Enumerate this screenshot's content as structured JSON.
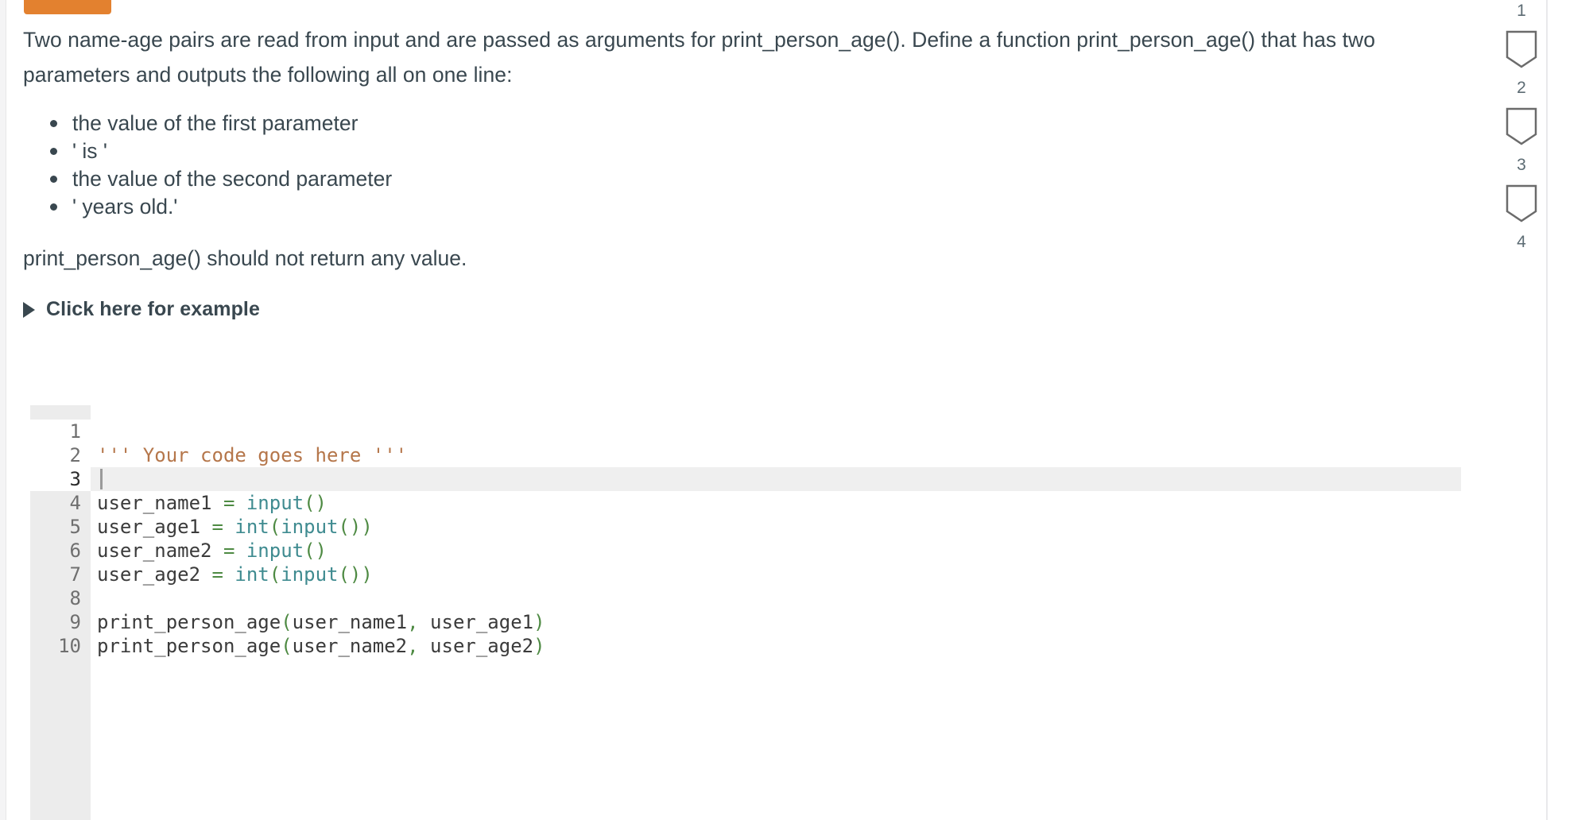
{
  "theme": {
    "accent_orange": "#e3812f",
    "text_color": "#39474f",
    "code_string_color": "#b5764a",
    "code_operator_color": "#4e8a43",
    "code_function_color": "#3f8b90",
    "gutter_bg": "#ececec",
    "active_line_bg": "#efefef",
    "rail_shape_stroke": "#6b6b6b",
    "rail_number_color": "#5c6b73"
  },
  "prompt": {
    "paragraph": "Two name-age pairs are read from input and are passed as arguments for print_person_age(). Define a function print_person_age() that has two parameters and outputs the following all on one line:",
    "bullets": [
      "the value of the first parameter",
      "' is '",
      "the value of the second parameter",
      "' years old.'"
    ],
    "closing": "print_person_age() should not return any value."
  },
  "disclosure": {
    "label": "Click here for example",
    "icon": "triangle-right-icon",
    "expanded": false
  },
  "editor": {
    "language": "python",
    "active_line": 3,
    "cursor_line": 3,
    "cursor_column": 1,
    "lines": [
      {
        "number": "1",
        "text": ""
      },
      {
        "number": "2",
        "text": "''' Your code goes here '''"
      },
      {
        "number": "3",
        "text": ""
      },
      {
        "number": "4",
        "text": "user_name1 = input()"
      },
      {
        "number": "5",
        "text": "user_age1 = int(input())"
      },
      {
        "number": "6",
        "text": "user_name2 = input()"
      },
      {
        "number": "7",
        "text": "user_age2 = int(input())"
      },
      {
        "number": "8",
        "text": ""
      },
      {
        "number": "9",
        "text": "print_person_age(user_name1, user_age1)"
      },
      {
        "number": "10",
        "text": "print_person_age(user_name2, user_age2)"
      }
    ],
    "line_numbers": [
      "1",
      "2",
      "3",
      "4",
      "5",
      "6",
      "7",
      "8",
      "9",
      "10"
    ]
  },
  "right_rail": {
    "steps": [
      {
        "number": "1",
        "shape": "shield-marker-icon"
      },
      {
        "number": "2",
        "shape": "shield-marker-icon"
      },
      {
        "number": "3",
        "shape": "shield-marker-icon"
      },
      {
        "number": "4",
        "shape": ""
      }
    ]
  }
}
